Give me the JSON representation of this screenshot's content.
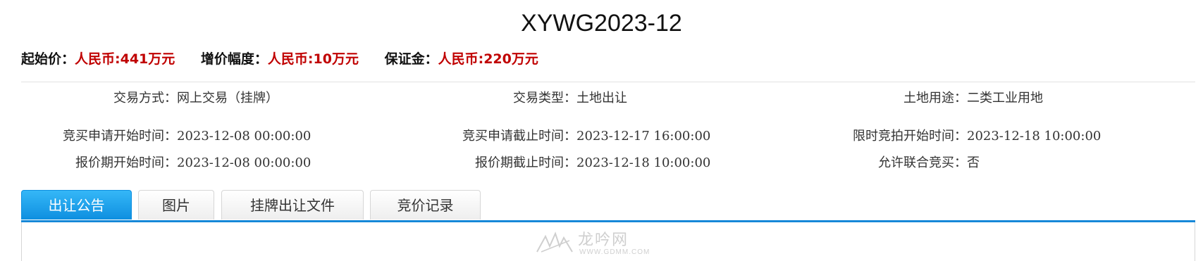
{
  "header": {
    "title": "XYWG2023-12"
  },
  "prices": [
    {
      "label": "起始价：",
      "value": "人民币:441万元"
    },
    {
      "label": "增价幅度：",
      "value": "人民币:10万元"
    },
    {
      "label": "保证金：",
      "value": "人民币:220万元"
    }
  ],
  "info": {
    "trade_method": {
      "label": "交易方式：",
      "value": "网上交易（挂牌）"
    },
    "trade_type": {
      "label": "交易类型：",
      "value": "土地出让"
    },
    "land_use": {
      "label": "土地用途：",
      "value": "二类工业用地"
    },
    "apply_start": {
      "label": "竞买申请开始时间：",
      "value": "2023-12-08 00:00:00"
    },
    "apply_end": {
      "label": "竞买申请截止时间：",
      "value": "2023-12-17 16:00:00"
    },
    "auction_start": {
      "label": "限时竞拍开始时间：",
      "value": "2023-12-18 10:00:00"
    },
    "quote_start": {
      "label": "报价期开始时间：",
      "value": "2023-12-08 00:00:00"
    },
    "quote_end": {
      "label": "报价期截止时间：",
      "value": "2023-12-18 10:00:00"
    },
    "joint_bid": {
      "label": "允许联合竞买：",
      "value": "否"
    }
  },
  "tabs": [
    {
      "label": "出让公告",
      "active": true
    },
    {
      "label": "图片",
      "active": false
    },
    {
      "label": "挂牌出让文件",
      "active": false
    },
    {
      "label": "竞价记录",
      "active": false
    }
  ],
  "watermark": {
    "text": "龙吟网",
    "sub": "WWW.GDMM.COM"
  },
  "colors": {
    "price_value": "#c00000",
    "tab_active": "#1a9cec",
    "panel_border": "#1688d8"
  }
}
